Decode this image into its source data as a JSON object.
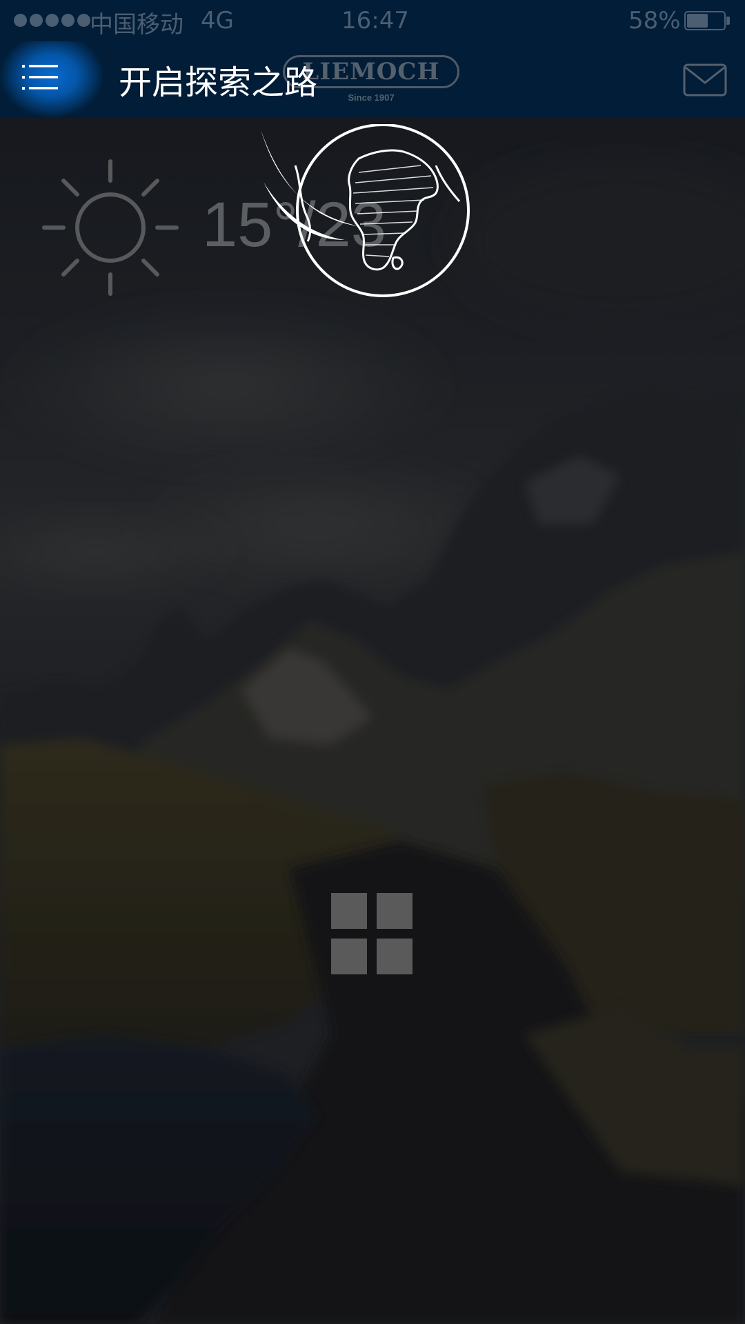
{
  "status_bar": {
    "carrier": "中国移动",
    "network": "4G",
    "time": "16:47",
    "battery_percent_text": "58%",
    "battery_level": 0.58,
    "signal_bars": 5
  },
  "nav_bar": {
    "menu_icon": "hamburger-menu-icon",
    "title": "开启探索之路",
    "brand_name": "LIEMOCH",
    "brand_tagline": "Since 1907",
    "mail_icon": "envelope-icon"
  },
  "weather": {
    "icon": "sun-icon",
    "temperature": "15°/23"
  },
  "logo": {
    "icon": "globe-africa-icon"
  },
  "apps_button": {
    "icon": "grid-icon"
  },
  "colors": {
    "header_bg": "#011d37",
    "menu_highlight": "#0a6ad0",
    "status_text": "#4b5e72"
  }
}
